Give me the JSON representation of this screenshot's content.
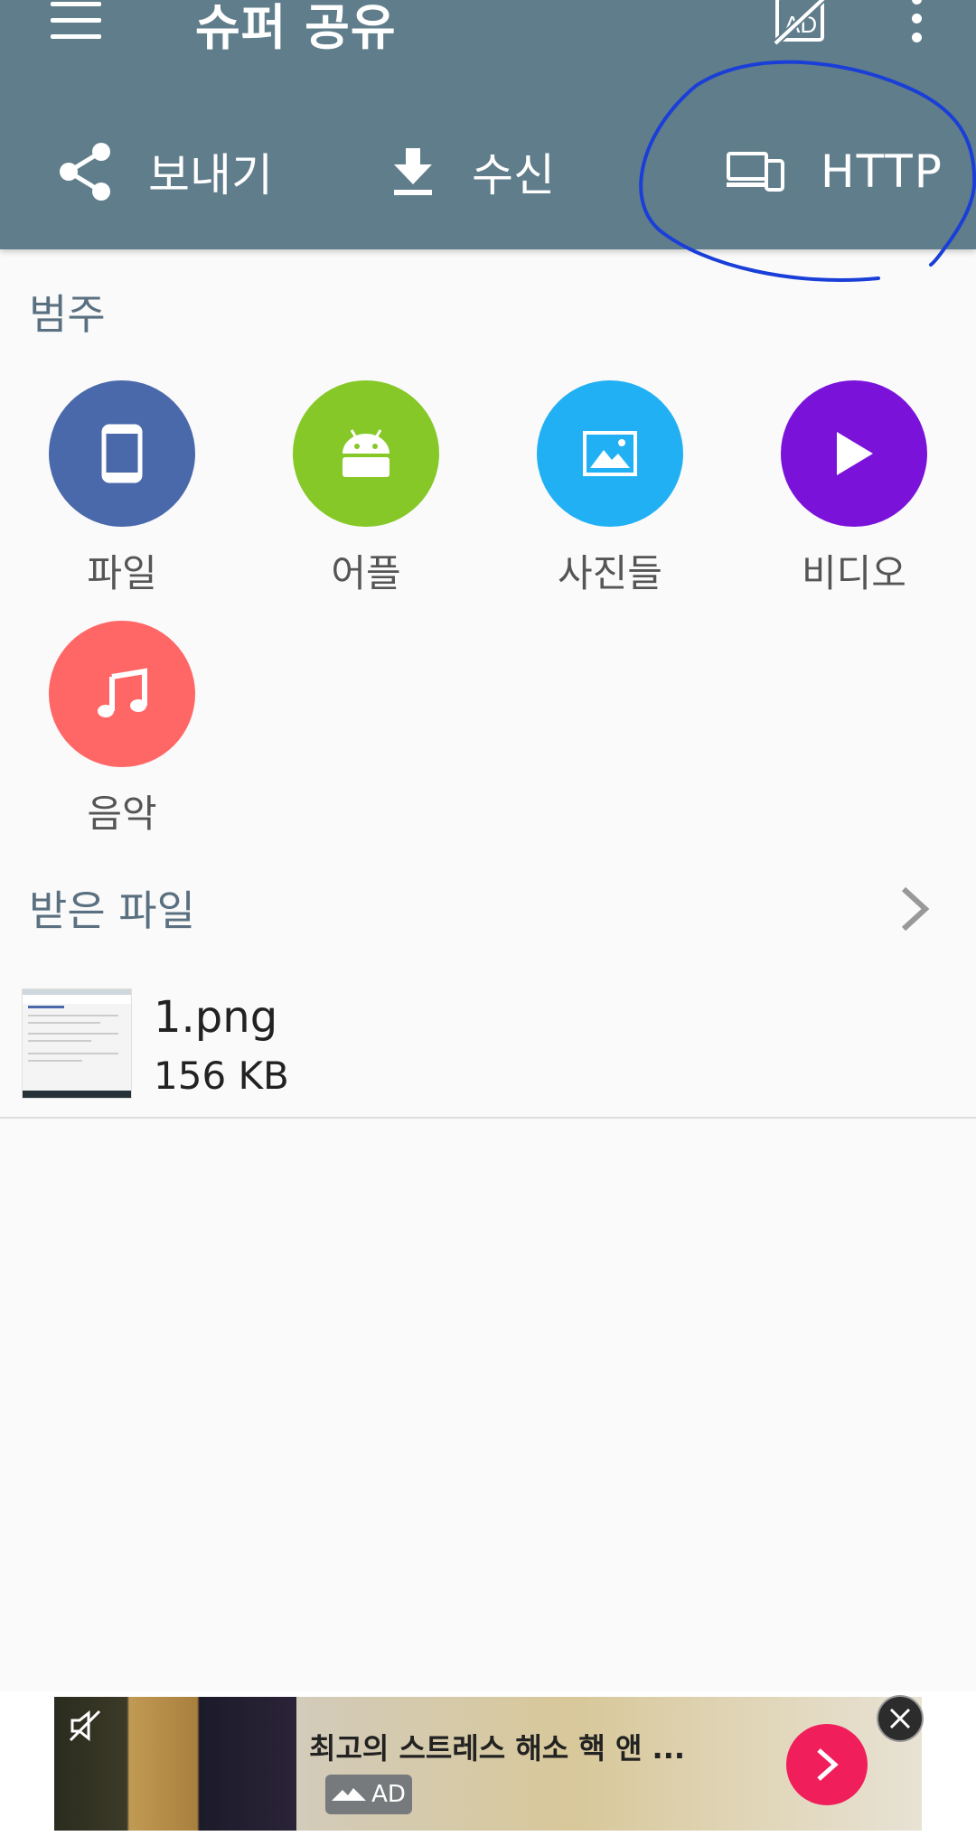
{
  "app_bar": {
    "title": "슈퍼 공유",
    "tabs": [
      {
        "label": "보내기",
        "icon": "share-icon"
      },
      {
        "label": "수신",
        "icon": "download-icon"
      },
      {
        "label": "HTTP",
        "icon": "devices-icon"
      }
    ]
  },
  "categories": {
    "title": "범주",
    "items": [
      {
        "label": "파일",
        "icon": "phone-icon",
        "color": "#4a69ab"
      },
      {
        "label": "어플",
        "icon": "android-icon",
        "color": "#86c827"
      },
      {
        "label": "사진들",
        "icon": "image-icon",
        "color": "#22b0f4"
      },
      {
        "label": "비디오",
        "icon": "play-icon",
        "color": "#7b12da"
      },
      {
        "label": "음악",
        "icon": "music-note-icon",
        "color": "#ff6766"
      }
    ]
  },
  "received": {
    "title": "받은 파일",
    "files": [
      {
        "name": "1.png",
        "size": "156 KB"
      }
    ]
  },
  "ad": {
    "text": "최고의 스트레스 해소 핵 앤 ...",
    "badge": "AD"
  },
  "colors": {
    "app_bar": "#607d8b",
    "annotation": "#1a3fd8"
  }
}
